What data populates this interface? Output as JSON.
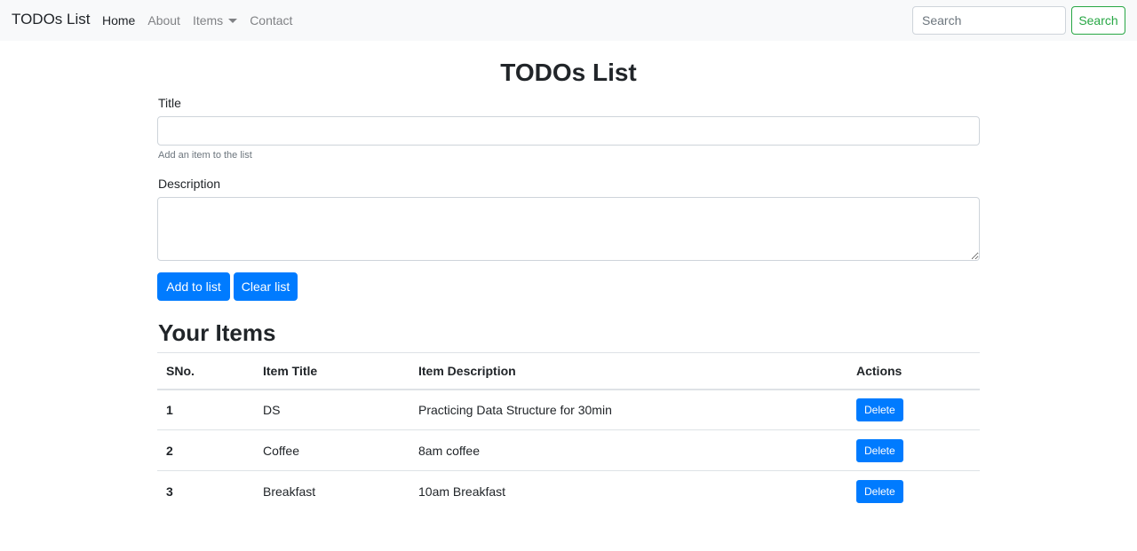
{
  "navbar": {
    "brand": "TODOs List",
    "links": [
      {
        "label": "Home",
        "active": true
      },
      {
        "label": "About",
        "active": false
      },
      {
        "label": "Items",
        "active": false,
        "dropdown": true
      },
      {
        "label": "Contact",
        "active": false
      }
    ],
    "search": {
      "placeholder": "Search",
      "button_label": "Search"
    }
  },
  "form": {
    "heading": "TODOs List",
    "title_label": "Title",
    "title_value": "",
    "title_help": "Add an item to the list",
    "description_label": "Description",
    "description_value": "",
    "add_label": "Add to list",
    "clear_label": "Clear list"
  },
  "items": {
    "heading": "Your Items",
    "columns": [
      "SNo.",
      "Item Title",
      "Item Description",
      "Actions"
    ],
    "rows": [
      {
        "sno": "1",
        "title": "DS",
        "description": "Practicing Data Structure for 30min",
        "action": "Delete"
      },
      {
        "sno": "2",
        "title": "Coffee",
        "description": "8am coffee",
        "action": "Delete"
      },
      {
        "sno": "3",
        "title": "Breakfast",
        "description": "10am Breakfast",
        "action": "Delete"
      }
    ]
  },
  "colors": {
    "primary": "#007bff",
    "success": "#28a745",
    "navbar_bg": "#f8f9fa"
  }
}
